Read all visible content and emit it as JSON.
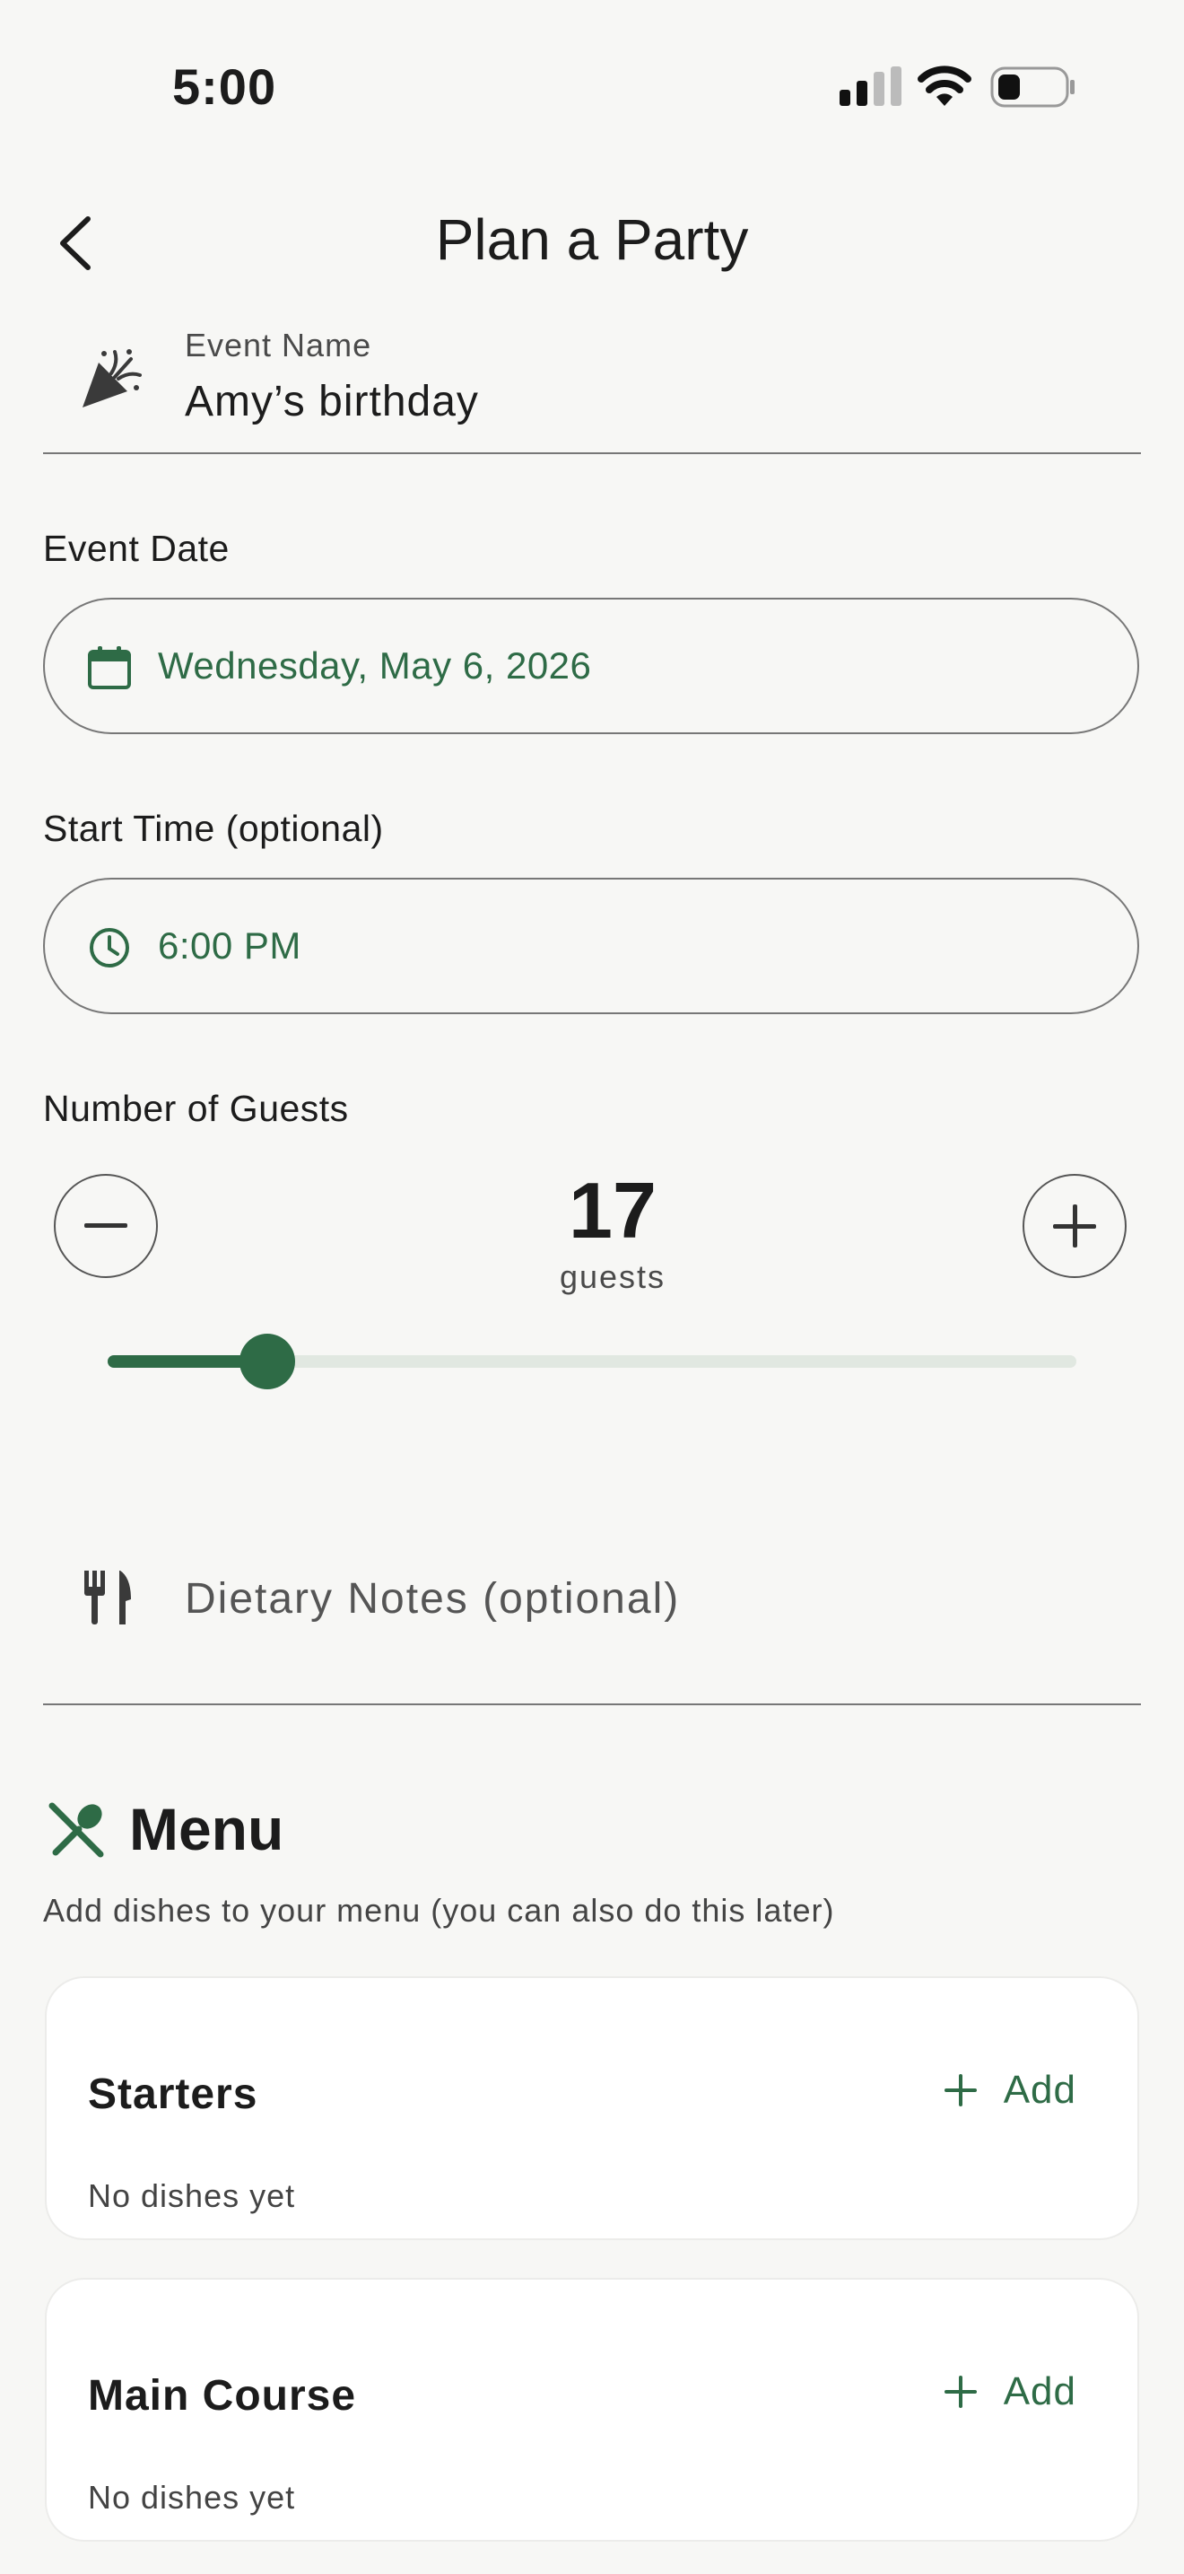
{
  "status_bar": {
    "time": "5:00"
  },
  "nav": {
    "title": "Plan a Party"
  },
  "event_name": {
    "label": "Event Name",
    "value": "Amy’s birthday"
  },
  "event_date": {
    "label": "Event Date",
    "value": "Wednesday, May 6, 2026"
  },
  "start_time": {
    "label": "Start Time (optional)",
    "value": "6:00 PM"
  },
  "guests": {
    "label": "Number of Guests",
    "count": "17",
    "unit": "guests",
    "slider_fraction": 0.165
  },
  "dietary": {
    "placeholder": "Dietary Notes (optional)"
  },
  "menu": {
    "title": "Menu",
    "subtitle": "Add dishes to your menu (you can also do this later)",
    "sections": [
      {
        "title": "Starters",
        "add_label": "Add",
        "empty_text": "No dishes yet"
      },
      {
        "title": "Main Course",
        "add_label": "Add",
        "empty_text": "No dishes yet"
      }
    ]
  },
  "colors": {
    "accent": "#2e6b46",
    "background": "#f7f7f5",
    "card": "#ffffff",
    "track": "#e1e8e1"
  }
}
